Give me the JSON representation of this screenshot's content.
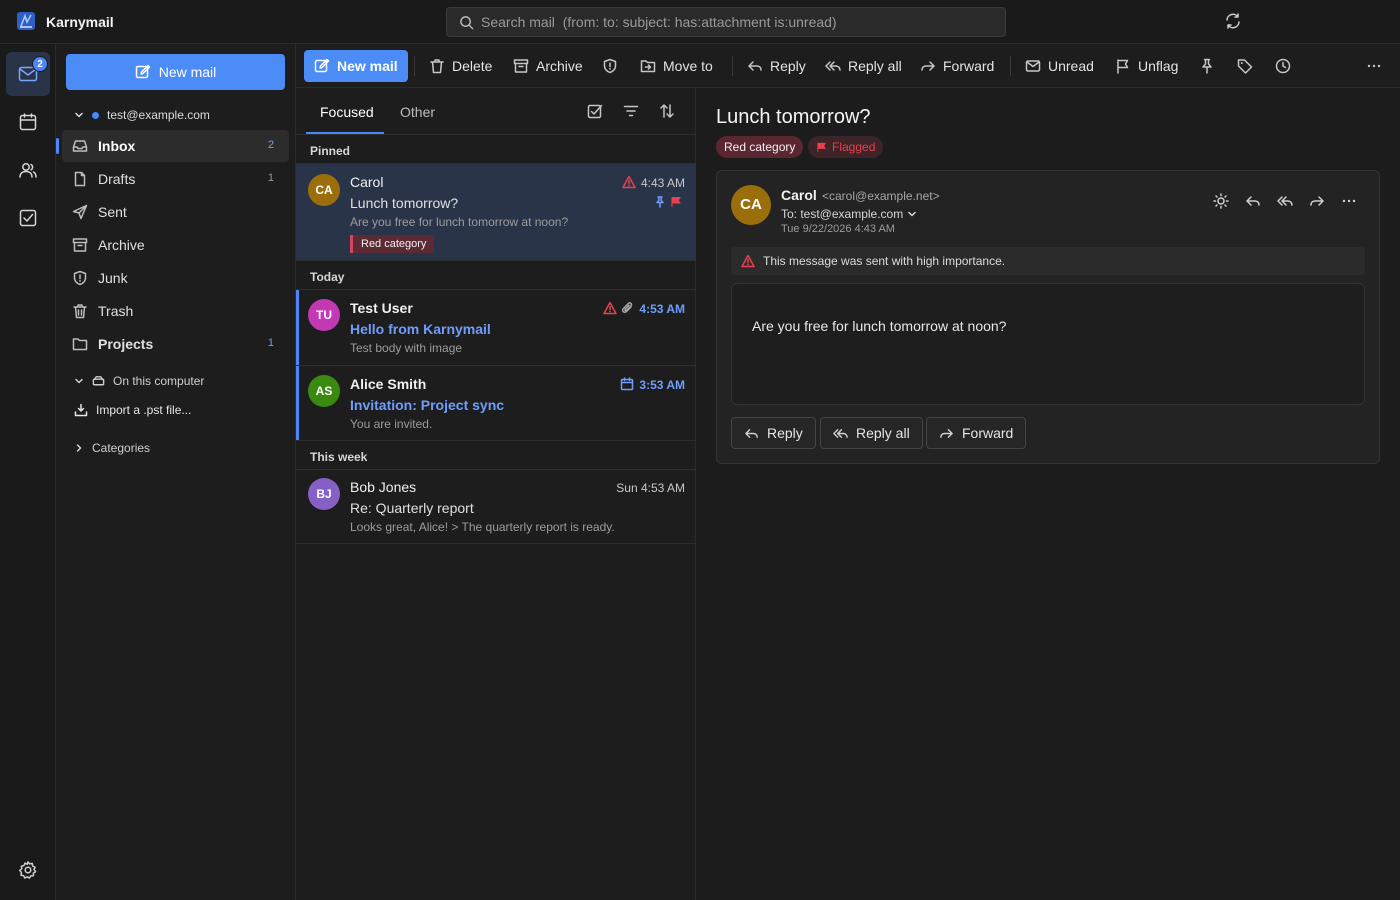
{
  "app": {
    "title": "Karnymail"
  },
  "search": {
    "placeholder": "Search mail  (from: to: subject: has:attachment is:unread)"
  },
  "rail": {
    "mail_badge": "2"
  },
  "folders": {
    "new_mail_label": "New mail",
    "account": "test@example.com",
    "items": [
      {
        "label": "Inbox",
        "count": "2"
      },
      {
        "label": "Drafts",
        "count": "1"
      },
      {
        "label": "Sent",
        "count": ""
      },
      {
        "label": "Archive",
        "count": ""
      },
      {
        "label": "Junk",
        "count": ""
      },
      {
        "label": "Trash",
        "count": ""
      },
      {
        "label": "Projects",
        "count": "1"
      }
    ],
    "local_section": "On this computer",
    "import_label": "Import a .pst file...",
    "categories_label": "Categories"
  },
  "toolbar": {
    "new_mail": "New mail",
    "delete": "Delete",
    "archive": "Archive",
    "move_to": "Move to",
    "reply": "Reply",
    "reply_all": "Reply all",
    "forward": "Forward",
    "unread": "Unread",
    "unflag": "Unflag"
  },
  "list": {
    "tabs": [
      "Focused",
      "Other"
    ],
    "groups": [
      "Pinned",
      "Today",
      "This week"
    ],
    "messages": [
      {
        "initials": "CA",
        "sender": "Carol",
        "subject": "Lunch tomorrow?",
        "preview": "Are you free for lunch tomorrow at noon?",
        "time": "4:43 AM",
        "category": "Red category",
        "avatar_color": "#9a6e0a"
      },
      {
        "initials": "TU",
        "sender": "Test User",
        "subject": "Hello from Karnymail",
        "preview": "Test body with image",
        "time": "4:53 AM",
        "avatar_color": "#c239b3"
      },
      {
        "initials": "AS",
        "sender": "Alice Smith",
        "subject": "Invitation: Project sync",
        "preview": "You are invited.",
        "time": "3:53 AM",
        "avatar_color": "#3a8a10"
      },
      {
        "initials": "BJ",
        "sender": "Bob Jones",
        "subject": "Re: Quarterly report",
        "preview": "Looks great, Alice! > The quarterly report is ready.",
        "time": "Sun 4:53 AM",
        "avatar_color": "#8560c5"
      }
    ]
  },
  "reading": {
    "subject": "Lunch tomorrow?",
    "category_tag": "Red category",
    "flag_tag": "Flagged",
    "from_initials": "CA",
    "from_name": "Carol",
    "from_email": "<carol@example.net>",
    "to": "To: test@example.com",
    "date": "Tue 9/22/2026 4:43 AM",
    "importance_banner": "This message was sent with high importance.",
    "body": "Are you free for lunch tomorrow at noon?",
    "reply": "Reply",
    "reply_all": "Reply all",
    "forward": "Forward"
  },
  "colors": {
    "accent": "#4c86f9",
    "flag": "#e8404e",
    "category_red": "#d6455e"
  }
}
